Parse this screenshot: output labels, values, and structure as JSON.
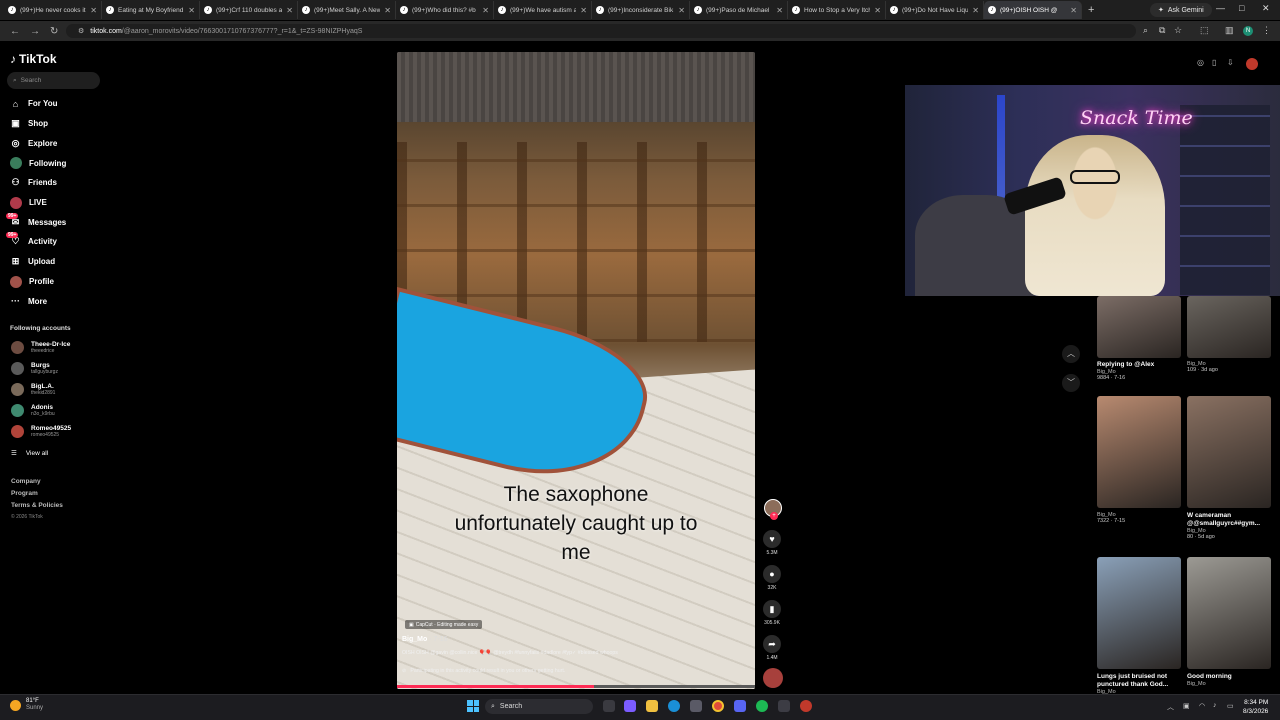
{
  "browser": {
    "tabs": [
      {
        "title": "(99+)He never cooks it"
      },
      {
        "title": "Eating at My Boyfriend"
      },
      {
        "title": "(99+)Crf 110 doubles a"
      },
      {
        "title": "(99+)Meet Sally. A New"
      },
      {
        "title": "(99+)Who did this? #b"
      },
      {
        "title": "(99+)We have autism a"
      },
      {
        "title": "(99+)Inconsiderate Bik"
      },
      {
        "title": "(99+)Paso de Michael"
      },
      {
        "title": "How to Stop a Very Itch"
      },
      {
        "title": "(99+)Do Not Have Liqu"
      },
      {
        "title": "(99+)OISH OISH @"
      }
    ],
    "gemini_label": "Ask Gemini",
    "url_domain": "tiktok.com",
    "url_path": "/@aaron_morovits/video/7663001710767376777?_r=1&_t=ZS-98NIZPHyaqS",
    "profile_initial": "N"
  },
  "sidebar": {
    "logo": "TikTok",
    "search_placeholder": "Search",
    "nav": [
      {
        "label": "For You",
        "icon": "home-icon"
      },
      {
        "label": "Shop",
        "icon": "shop-icon"
      },
      {
        "label": "Explore",
        "icon": "compass-icon"
      },
      {
        "label": "Following",
        "icon": "following-avatar-icon"
      },
      {
        "label": "Friends",
        "icon": "friends-icon"
      },
      {
        "label": "LIVE",
        "icon": "live-icon"
      },
      {
        "label": "Messages",
        "icon": "messages-icon",
        "badge": "99+"
      },
      {
        "label": "Activity",
        "icon": "activity-icon",
        "badge": "99+"
      },
      {
        "label": "Upload",
        "icon": "upload-icon"
      },
      {
        "label": "Profile",
        "icon": "profile-avatar-icon"
      },
      {
        "label": "More",
        "icon": "more-icon"
      }
    ],
    "following_header": "Following accounts",
    "accounts": [
      {
        "name": "Theee-Dr-Ice",
        "handle": "theeedrice"
      },
      {
        "name": "Burgs",
        "handle": "tallguyburgz"
      },
      {
        "name": "BigL.A.",
        "handle": "thekid2891"
      },
      {
        "name": "Adonis",
        "handle": "n3o_k9rbu"
      },
      {
        "name": "Romeo49525",
        "handle": "romeo49525"
      }
    ],
    "view_all": "View all",
    "footer": [
      "Company",
      "Program",
      "Terms & Policies"
    ],
    "copyright": "© 2026 TikTok"
  },
  "video": {
    "caption_lines": [
      "The saxophone",
      "unfortunately caught up to",
      "me"
    ],
    "capcut": "CapCut · Editing made easy",
    "author": "Big_Mo",
    "date": "· 7-16",
    "description": "OISH OISH @gavin @collin.nice 🎈🎈 @treydh #funnyfails #dadlore #fyp✓ #blessed whoops",
    "warning": "Participating in this activity could result in you or others getting hurt.",
    "progress": 0.55
  },
  "actions": {
    "likes": "5.3M",
    "comments": "32K",
    "saves": "305.9K",
    "shares": "1.4M"
  },
  "webcam": {
    "neon": "Snack Time"
  },
  "related": [
    {
      "title": "Replying to @Alex",
      "user": "Big_Mo",
      "stats": "9884 · 7-16",
      "color": "#7c6d66"
    },
    {
      "title": "",
      "user": "Big_Mo",
      "stats": "109 · 3d ago",
      "color": "#6a655f"
    },
    {
      "title": "",
      "user": "Big_Mo",
      "stats": "7322 · 7-15",
      "color": "#b88a70"
    },
    {
      "title": "W cameraman @@smallguyrc##gym...",
      "user": "Big_Mo",
      "stats": "80 · 5d ago",
      "color": "#8a7162"
    },
    {
      "title": "Lungs just bruised not punctured thank God...",
      "user": "Big_Mo",
      "stats": "",
      "color": "#8aa0b8"
    },
    {
      "title": "Good morning",
      "user": "Big_Mo",
      "stats": "",
      "color": "#9c9a94"
    }
  ],
  "taskbar": {
    "temp": "81°F",
    "condition": "Sunny",
    "search": "Search",
    "time": "8:34 PM",
    "date": "8/3/2026"
  },
  "colors": {
    "accent": "#fe2c55",
    "pool": "#1aa4e0",
    "background": "#000000"
  }
}
